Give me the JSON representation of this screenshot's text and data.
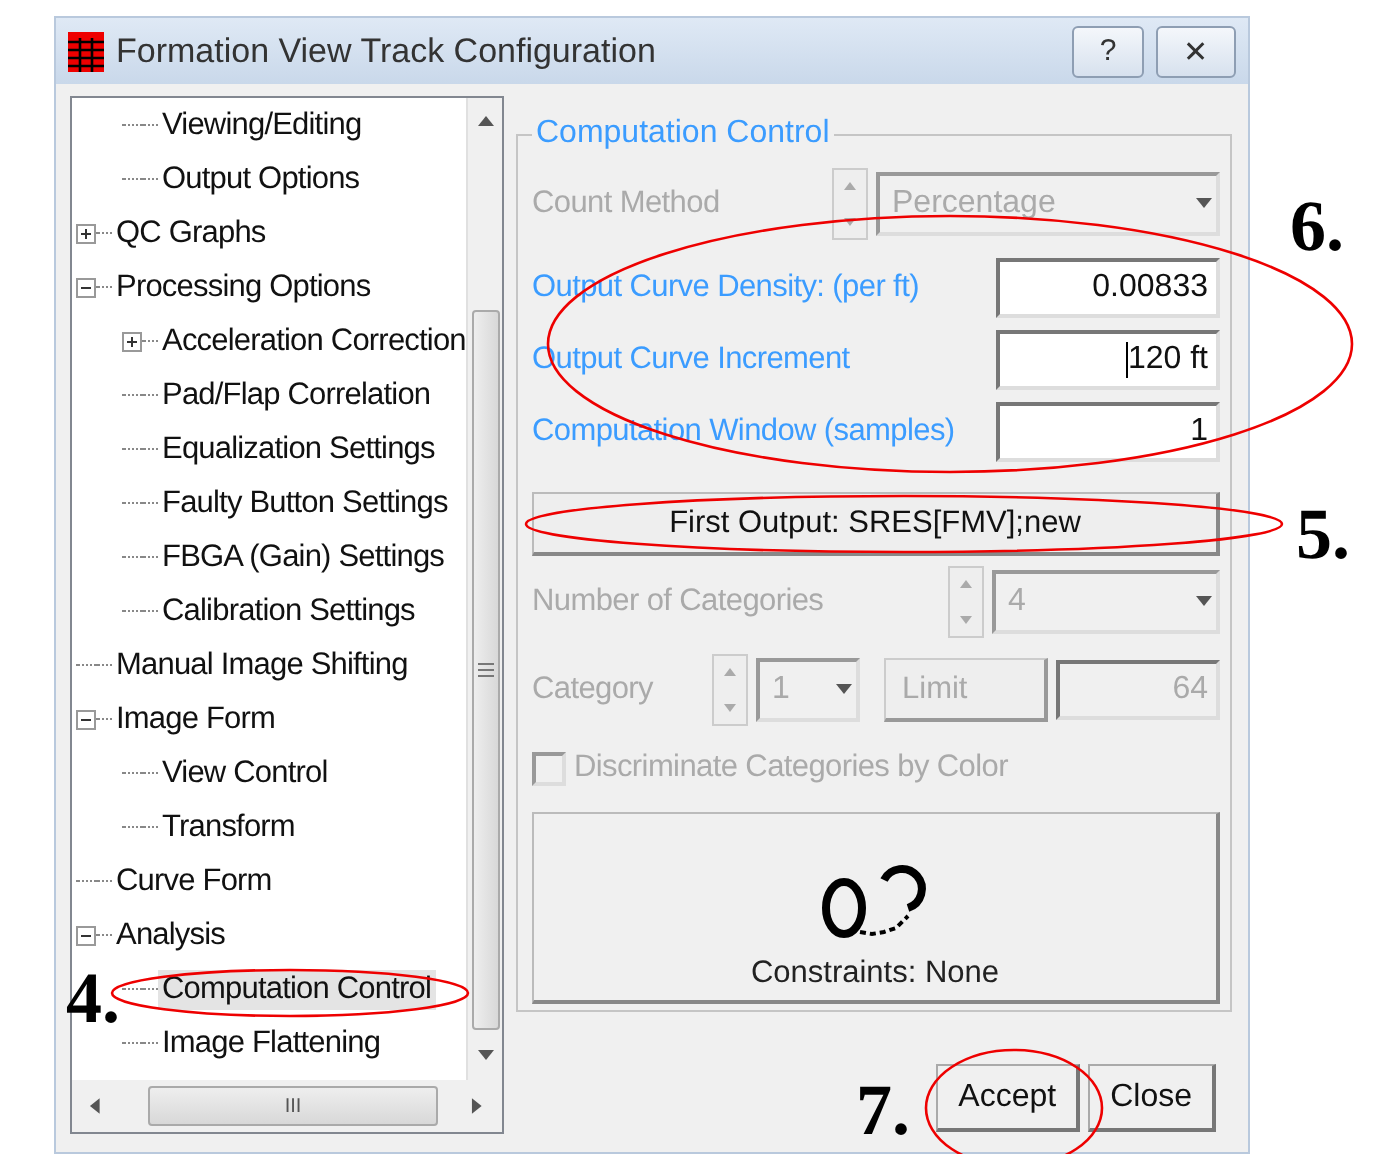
{
  "window": {
    "title": "Formation View Track Configuration",
    "buttons": [
      {
        "kind": "help",
        "label": "?"
      },
      {
        "kind": "close",
        "label": "✕"
      }
    ]
  },
  "tree": {
    "continued_items": [
      {
        "label": "Viewing/Editing",
        "selected": false
      },
      {
        "label": "Output Options",
        "selected": false
      }
    ],
    "items": [
      {
        "label": "QC Graphs",
        "selected": false,
        "expanded": false
      },
      {
        "label": "Processing Options",
        "selected": false,
        "expanded": true,
        "children": [
          {
            "label": "Acceleration Correction",
            "selected": false,
            "expanded": false
          },
          {
            "label": "Pad/Flap Correlation",
            "selected": false
          },
          {
            "label": "Equalization Settings",
            "selected": false
          },
          {
            "label": "Faulty Button Settings",
            "selected": false
          },
          {
            "label": "FBGA (Gain) Settings",
            "selected": false
          },
          {
            "label": "Calibration Settings",
            "selected": false
          }
        ]
      },
      {
        "label": "Manual Image Shifting",
        "selected": false
      },
      {
        "label": "Image Form",
        "selected": false,
        "expanded": true,
        "children": [
          {
            "label": "View Control",
            "selected": false
          },
          {
            "label": "Transform",
            "selected": false
          }
        ]
      },
      {
        "label": "Curve Form",
        "selected": false
      },
      {
        "label": "Analysis",
        "selected": false,
        "expanded": true,
        "children": [
          {
            "label": "Computation Control",
            "selected": true
          },
          {
            "label": "Image Flattening",
            "selected": false
          }
        ]
      }
    ],
    "hscroll_label": "III"
  },
  "group": {
    "title": "Computation Control",
    "rows": [
      {
        "kind": "select",
        "label": "Count Method",
        "value": "Percentage",
        "disabled": true
      },
      {
        "kind": "field",
        "label": "Output Curve Density:  (per ft)",
        "value": "0.00833",
        "disabled": false
      },
      {
        "kind": "field",
        "label": "Output Curve Increment",
        "value": "120 ft",
        "disabled": false,
        "focused": true
      },
      {
        "kind": "field",
        "label": "Computation Window (samples)",
        "value": "1",
        "disabled": false
      }
    ],
    "first_output": "First Output:  SRES[FMV];new",
    "categories": {
      "label": "Number of Categories",
      "value": "4",
      "disabled": true
    },
    "category": {
      "label": "Category",
      "value": "1",
      "limit_button": "Limit",
      "limit": "64",
      "disabled": true
    },
    "checkbox": {
      "label": "Discriminate Categories by Color",
      "checked": false,
      "disabled": true
    },
    "constraints": "Constraints:  None"
  },
  "buttons": [
    {
      "label": "Accept"
    },
    {
      "label": "Close"
    }
  ],
  "annotations": [
    {
      "label": "4."
    },
    {
      "label": "5."
    },
    {
      "label": "6."
    },
    {
      "label": "7."
    }
  ]
}
